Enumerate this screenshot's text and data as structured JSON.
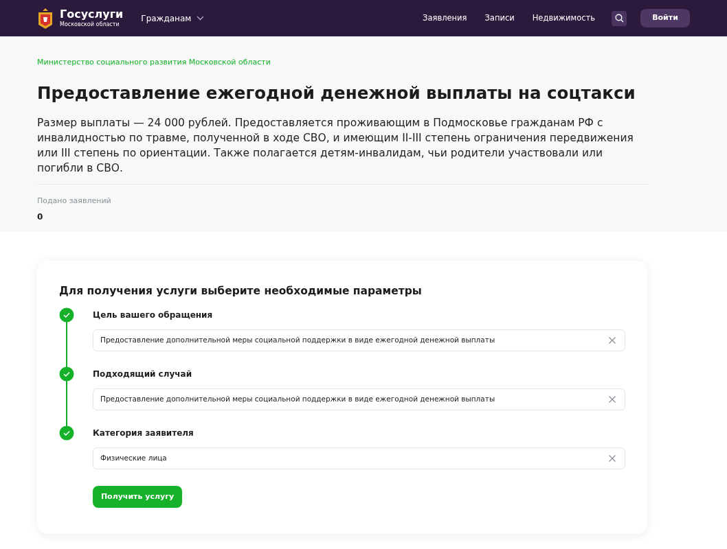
{
  "header": {
    "logo_title": "Госуслуги",
    "logo_subtitle": "Московской области",
    "menu": "Гражданам",
    "nav": [
      "Заявления",
      "Записи",
      "Недвижимость"
    ],
    "login": "Войти"
  },
  "service": {
    "ministry": "Министерство социального развития Московской области",
    "title": "Предоставление ежегодной денежной выплаты на соцтакси",
    "description": "Размер выплаты — 24 000 рублей. Предоставляется проживающим в Подмосковье гражданам РФ с инвалидностью по травме, полученной в ходе СВО, и имеющим II-III степень ограничения передвижения или III степень по ориентации. Также полагается детям-инвалидам, чьи родители участвовали или погибли в СВО.",
    "stat_label": "Подано заявлений",
    "stat_value": "0"
  },
  "form": {
    "title": "Для получения услуги выберите необходимые параметры",
    "steps": [
      {
        "label": "Цель вашего обращения",
        "value": "Предоставление дополнительной меры социальной поддержки в виде ежегодной денежной выплаты",
        "completed": true
      },
      {
        "label": "Подходящий случай",
        "value": "Предоставление дополнительной меры социальной поддержки в виде ежегодной денежной выплаты",
        "completed": true
      },
      {
        "label": "Категория заявителя",
        "value": "Физические лица",
        "completed": true
      }
    ],
    "submit": "Получить услугу"
  }
}
